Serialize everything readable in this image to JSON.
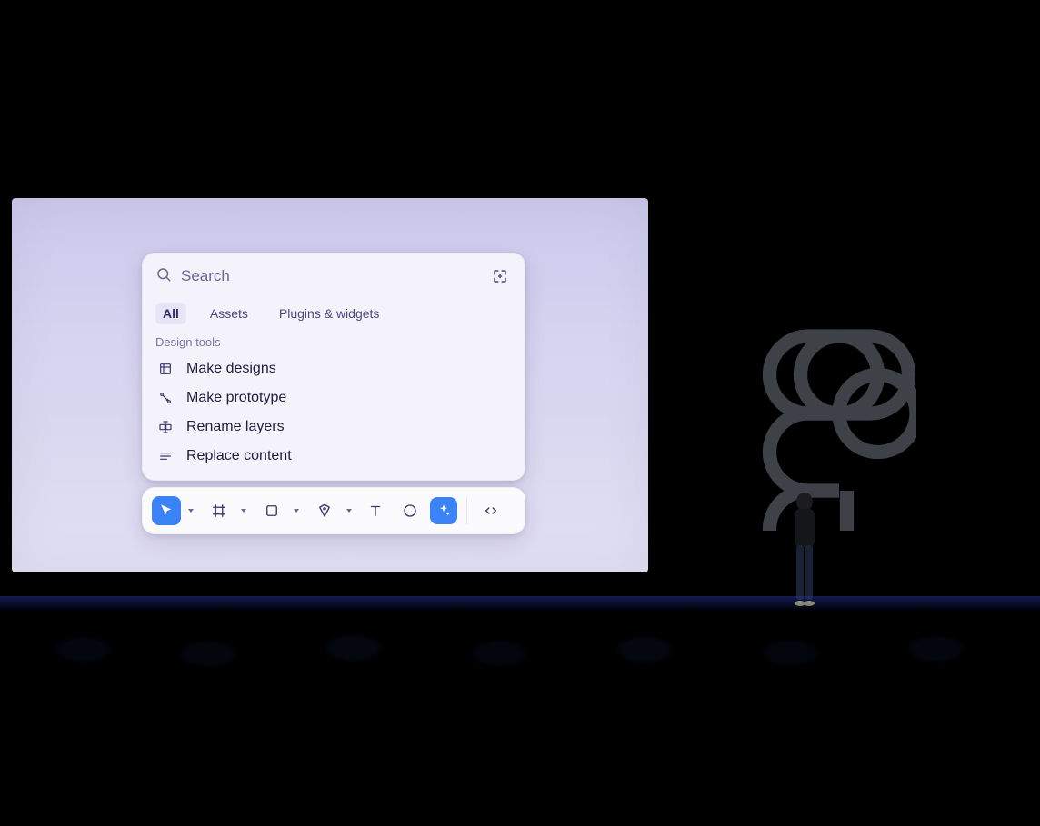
{
  "palette": {
    "search_placeholder": "Search",
    "tabs": [
      {
        "label": "All",
        "active": true
      },
      {
        "label": "Assets",
        "active": false
      },
      {
        "label": "Plugins & widgets",
        "active": false
      }
    ],
    "section_label": "Design tools",
    "items": [
      {
        "label": "Make designs",
        "icon": "frame-icon"
      },
      {
        "label": "Make prototype",
        "icon": "prototype-icon"
      },
      {
        "label": "Rename layers",
        "icon": "rename-icon"
      },
      {
        "label": "Replace content",
        "icon": "replace-content-icon"
      }
    ]
  },
  "toolbar": {
    "tools": [
      {
        "name": "move-tool",
        "active": true,
        "has_caret": true
      },
      {
        "name": "frame-tool",
        "active": false,
        "has_caret": true
      },
      {
        "name": "shape-tool",
        "active": false,
        "has_caret": true
      },
      {
        "name": "pen-tool",
        "active": false,
        "has_caret": true
      },
      {
        "name": "text-tool",
        "active": false,
        "has_caret": false
      },
      {
        "name": "comment-tool",
        "active": false,
        "has_caret": false
      },
      {
        "name": "actions-tool",
        "active": false,
        "accent": true
      },
      {
        "name": "dev-mode-tool",
        "active": false
      }
    ]
  }
}
